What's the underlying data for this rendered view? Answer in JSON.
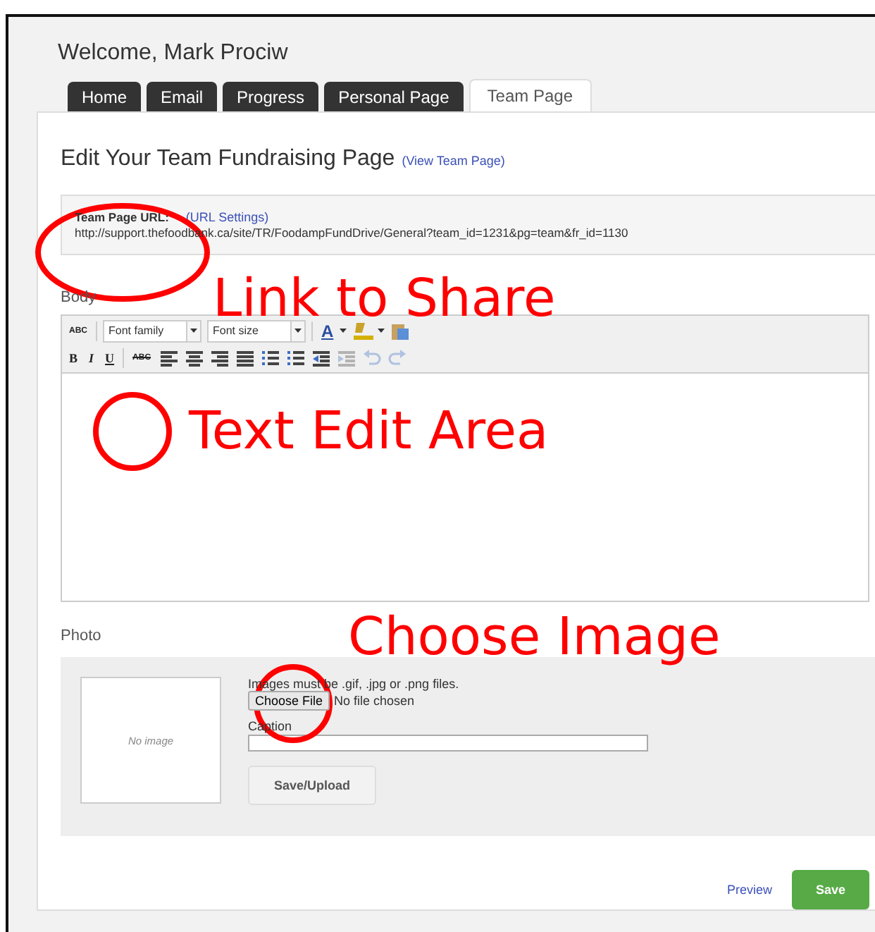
{
  "welcome": "Welcome, Mark Prociw",
  "tabs": [
    {
      "label": "Home",
      "selected": false
    },
    {
      "label": "Email",
      "selected": false
    },
    {
      "label": "Progress",
      "selected": false
    },
    {
      "label": "Personal Page",
      "selected": false
    },
    {
      "label": "Team Page",
      "selected": true
    }
  ],
  "heading": "Edit Your Team Fundraising Page",
  "heading_link": "(View Team Page)",
  "url_box": {
    "label": "Team Page URL:",
    "settings_link": "(URL Settings)",
    "url": "http://support.thefoodbank.ca/site/TR/FoodampFundDrive/General?team_id=1231&pg=team&fr_id=1130"
  },
  "body_label": "Body",
  "toolbar_row_1": [
    {
      "kind": "spellcheck",
      "text": "ABC"
    },
    {
      "kind": "select",
      "text": "Font family"
    },
    {
      "kind": "select",
      "text": "Font size"
    },
    {
      "kind": "textcolor",
      "text": "A"
    },
    {
      "kind": "highlight"
    },
    {
      "kind": "paste"
    }
  ],
  "toolbar_row_2": [
    {
      "kind": "bold",
      "text": "B",
      "disabled": false
    },
    {
      "kind": "italic",
      "text": "I",
      "disabled": false
    },
    {
      "kind": "underline",
      "text": "U",
      "disabled": false
    },
    {
      "kind": "strike",
      "text": "ABC",
      "disabled": false
    },
    {
      "kind": "align-left",
      "disabled": false
    },
    {
      "kind": "align-center",
      "disabled": false
    },
    {
      "kind": "align-right",
      "disabled": false
    },
    {
      "kind": "justify",
      "disabled": false
    },
    {
      "kind": "bullets",
      "disabled": false
    },
    {
      "kind": "numbers",
      "disabled": false
    },
    {
      "kind": "outdent",
      "disabled": false
    },
    {
      "kind": "indent",
      "disabled": true
    },
    {
      "kind": "undo",
      "disabled": true
    },
    {
      "kind": "redo",
      "disabled": true
    }
  ],
  "photo_label": "Photo",
  "photo": {
    "no_image": "No image",
    "hint": "Images must be .gif, .jpg or .png files.",
    "choose_button": "Choose File",
    "file_status": "No file chosen",
    "caption_label": "Caption",
    "upload_button": "Save/Upload"
  },
  "footer": {
    "preview_link": "Preview",
    "save_button": "Save"
  },
  "annotations": [
    {
      "kind": "ellipse-label",
      "text": "Link to Share"
    },
    {
      "kind": "circle-label",
      "text": "Text Edit Area"
    },
    {
      "kind": "circle-label",
      "text": "Choose Image"
    }
  ]
}
